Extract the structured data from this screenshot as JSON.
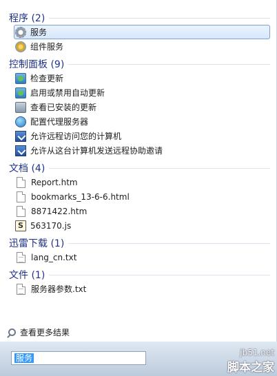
{
  "groups": [
    {
      "title": "程序 (2)",
      "items": [
        {
          "label": "服务",
          "icon": "gear-icon",
          "selected": true
        },
        {
          "label": "组件服务",
          "icon": "component-gear-icon"
        }
      ]
    },
    {
      "title": "控制面板 (9)",
      "items": [
        {
          "label": "检查更新",
          "icon": "windows-update-icon"
        },
        {
          "label": "启用或禁用自动更新",
          "icon": "windows-update-icon"
        },
        {
          "label": "查看已安装的更新",
          "icon": "installed-updates-icon"
        },
        {
          "label": "配置代理服务器",
          "icon": "internet-options-icon"
        },
        {
          "label": "允许远程访问您的计算机",
          "icon": "remote-access-icon"
        },
        {
          "label": "允许从这台计算机发送远程协助邀请",
          "icon": "remote-assistance-icon"
        }
      ]
    },
    {
      "title": "文档 (4)",
      "items": [
        {
          "label": "Report.htm",
          "icon": "html-file-icon"
        },
        {
          "label": "bookmarks_13-6-6.html",
          "icon": "html-file-icon"
        },
        {
          "label": "8871422.htm",
          "icon": "html-file-icon"
        },
        {
          "label": "563170.js",
          "icon": "script-file-icon"
        }
      ]
    },
    {
      "title": "迅雷下载 (1)",
      "items": [
        {
          "label": "lang_cn.txt",
          "icon": "text-file-icon"
        }
      ]
    },
    {
      "title": "文件 (1)",
      "items": [
        {
          "label": "服务器参数.txt",
          "icon": "text-file-icon"
        }
      ]
    }
  ],
  "see_more_label": "查看更多结果",
  "search": {
    "value": "服务"
  },
  "watermark": {
    "line1": "jb51.net",
    "line2": "脚本之家"
  }
}
